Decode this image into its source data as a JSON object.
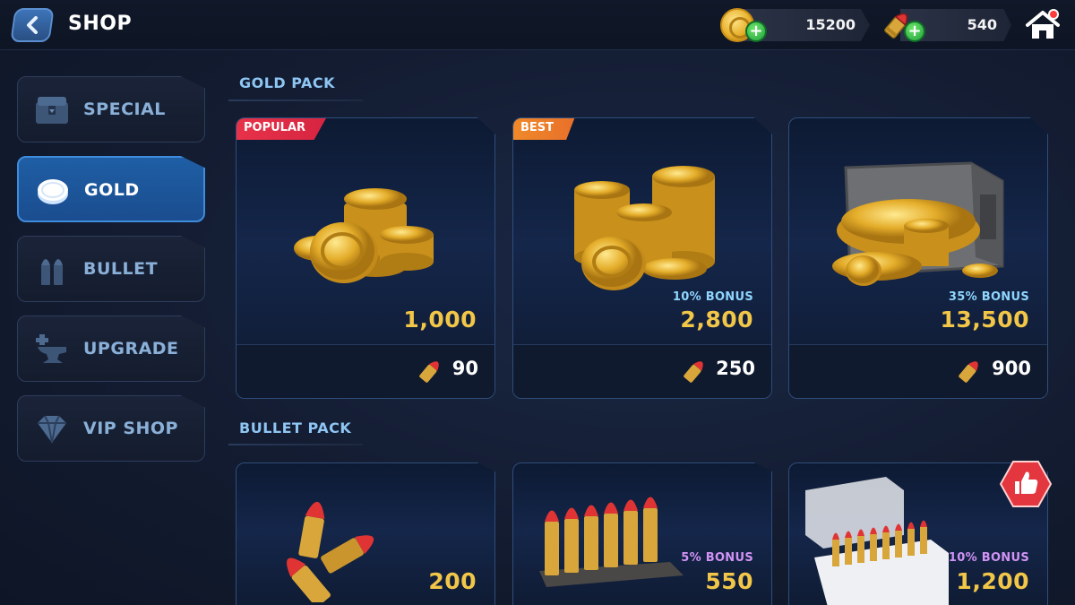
{
  "header": {
    "title": "SHOP",
    "gold_amount": "15200",
    "bullet_amount": "540"
  },
  "sidebar": {
    "items": [
      {
        "label": "SPECIAL",
        "icon": "chest-icon",
        "active": false
      },
      {
        "label": "GOLD",
        "icon": "coin-icon",
        "active": true
      },
      {
        "label": "BULLET",
        "icon": "bullets-icon",
        "active": false
      },
      {
        "label": "UPGRADE",
        "icon": "anvil-icon",
        "active": false
      },
      {
        "label": "VIP SHOP",
        "icon": "diamond-icon",
        "active": false
      }
    ]
  },
  "sections": {
    "gold_pack": {
      "title": "GOLD PACK",
      "cards": [
        {
          "badge": "POPULAR",
          "bonus": "",
          "amount": "1,000",
          "price": "90"
        },
        {
          "badge": "BEST",
          "bonus": "10% BONUS",
          "amount": "2,800",
          "price": "250"
        },
        {
          "badge": "",
          "bonus": "35% BONUS",
          "amount": "13,500",
          "price": "900"
        }
      ]
    },
    "bullet_pack": {
      "title": "BULLET PACK",
      "cards": [
        {
          "bonus": "",
          "amount": "200"
        },
        {
          "bonus": "5% BONUS",
          "amount": "550"
        },
        {
          "bonus": "10% BONUS",
          "amount": "1,200"
        }
      ]
    }
  },
  "colors": {
    "accent_blue": "#1f5ea5",
    "gold_text": "#f2c748",
    "bonus_blue": "#8fd6ff",
    "bonus_purple": "#d193f5",
    "popular_red": "#e8324a",
    "best_orange": "#f08a2a"
  }
}
